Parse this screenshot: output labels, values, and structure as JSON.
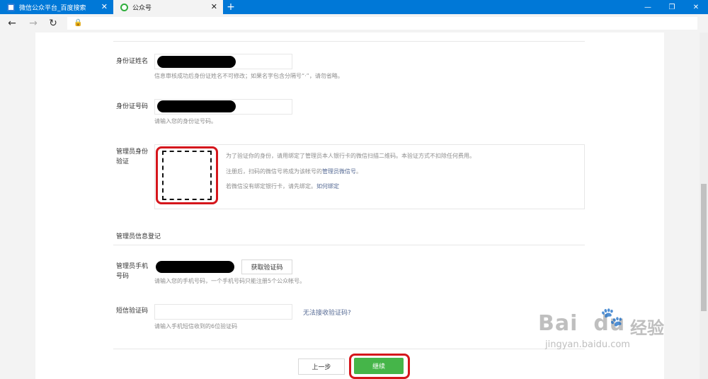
{
  "browser": {
    "tabs": [
      {
        "title": "微信公众平台_百度搜索",
        "close": "✕"
      },
      {
        "title": "公众号",
        "close": "✕"
      }
    ],
    "new_tab": "+",
    "window_controls": {
      "minimize": "—",
      "maximize": "❐",
      "close": "✕"
    },
    "nav": {
      "back": "←",
      "forward": "→",
      "reload": "↻",
      "lock": "🔒"
    },
    "accent": "#0078d7"
  },
  "form": {
    "id_name": {
      "label": "身份证姓名",
      "value": "",
      "tip": "信息审核成功后身份证姓名不可修改；如果名字包含分隔号“·”，请勿省略。"
    },
    "id_number": {
      "label": "身份证号码",
      "value": "",
      "tip": "请输入您的身份证号码。"
    },
    "admin_auth": {
      "label": "管理员身份验证",
      "line1": "为了验证你的身份，请用绑定了管理员本人银行卡的微信扫描二维码。本验证方式不扣除任何费用。",
      "line2_prefix": "注册后，扫码的微信号将成为该帐号的",
      "line2_link": "管理员微信号",
      "line2_suffix": "。",
      "line3_prefix": "若微信没有绑定银行卡，请先绑定。",
      "line3_link": "如何绑定"
    },
    "admin_section_title": "管理员信息登记",
    "phone": {
      "label": "管理员手机号码",
      "value": "",
      "get_code_button": "获取验证码",
      "tip": "请输入您的手机号码，一个手机号码只能注册5个公众帐号。"
    },
    "sms_code": {
      "label": "短信验证码",
      "value": "",
      "no_code_link": "无法接收验证码?",
      "tip": "请输入手机短信收到的6位验证码"
    },
    "prev_button": "上一步",
    "continue_button": "继续"
  },
  "watermark": {
    "logo": "Bai",
    "logo_suffix": "du",
    "cn": "经验",
    "url": "jingyan.baidu.com"
  },
  "colors": {
    "primary_green": "#45b549",
    "link": "#576b95",
    "highlight_red": "#d5161c"
  }
}
